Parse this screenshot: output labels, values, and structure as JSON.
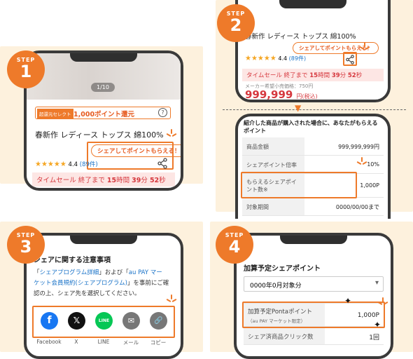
{
  "step_label": "STEP",
  "step1": {
    "num": "1",
    "image_counter": "1/10",
    "tag": "超還元セレクト",
    "points": "1,000ポイント還元",
    "help_icon": "?",
    "product_title": "春新作 レディース トップス 綿100%",
    "share_bubble": "シェアしてポイントもらえる！",
    "rating": "4.4",
    "reviews": "(89件)",
    "sale_prefix": "タイムセール 終了まで",
    "sale_h": "15",
    "sale_h_unit": "時間",
    "sale_m": "39",
    "sale_m_unit": "分",
    "sale_s": "52",
    "sale_s_unit": "秒"
  },
  "step2": {
    "num": "2",
    "product_title": "春新作 レディース トップス 綿100%",
    "share_bubble": "シェアしてポイントもらえる！",
    "rating": "4.4",
    "reviews": "(89件)",
    "sale_prefix": "タイムセール 終了まで",
    "sale_h": "15",
    "sale_h_unit": "時間",
    "sale_m": "39",
    "sale_m_unit": "分",
    "sale_s": "52",
    "sale_s_unit": "秒",
    "msrp": "メーカー希望小売価格：750円",
    "price": "999,999",
    "price_unit": "円(税込)",
    "arrow": "▼",
    "info_heading": "紹介した商品が購入された場合に、あなたがもらえるポイント",
    "rows": [
      {
        "k": "商品金額",
        "v": "999,999,999円"
      },
      {
        "k": "シェアポイント倍率",
        "v": "10%"
      },
      {
        "k": "もらえるシェアポイント数※",
        "v": "1,000P"
      },
      {
        "k": "対象期間",
        "v": "0000/00/00まで"
      }
    ]
  },
  "step3": {
    "num": "3",
    "heading": "シェアに関する注意事項",
    "line1_a": "「",
    "link1": "シェアプログラム詳細",
    "line1_b": "」および「",
    "link2_a": "au PAY マー",
    "link2_b": "ケット会員規約(シェアプログラム)",
    "line2_b": "」を事前にご確",
    "line3": "認の上、シェア先を選択してください。",
    "share_targets": [
      {
        "label": "Facebook",
        "icon": "facebook-icon",
        "glyph": "f",
        "color": "#1877f2"
      },
      {
        "label": "X",
        "icon": "x-icon",
        "glyph": "𝕏",
        "color": "#111111"
      },
      {
        "label": "LINE",
        "icon": "line-icon",
        "glyph": "LINE",
        "color": "#06c755"
      },
      {
        "label": "メール",
        "icon": "mail-icon",
        "glyph": "✉",
        "color": "#777777"
      },
      {
        "label": "コピー",
        "icon": "copy-link-icon",
        "glyph": "🔗",
        "color": "#777777"
      }
    ]
  },
  "step4": {
    "num": "4",
    "heading": "加算予定シェアポイント",
    "select_value": "0000年0月対象分",
    "select_caret": "▾",
    "pending_label": "加算予定Pontaポイント",
    "pending_sub": "（au PAY マーケット限定）",
    "pending_value": "1,000P",
    "clicks_label": "シェア済商品クリック数",
    "clicks_value": "1回"
  },
  "colors": {
    "accent": "#ee7a2a",
    "panel": "#fdf1dd",
    "sale_red": "#d6383e",
    "link": "#1a73c8"
  }
}
